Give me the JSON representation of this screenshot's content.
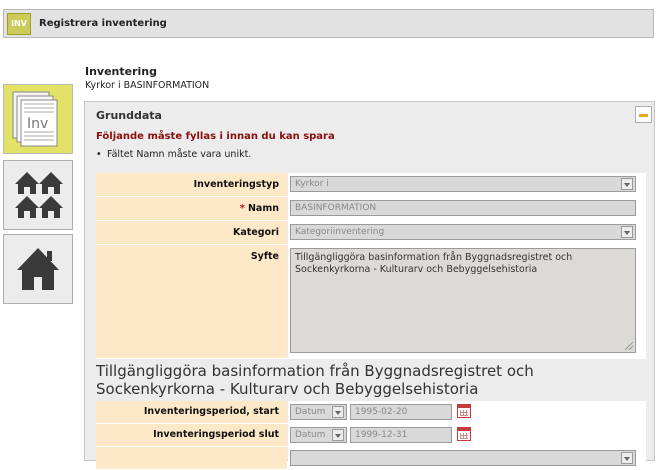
{
  "app": {
    "icon_text": "INV",
    "title": "Registrera inventering"
  },
  "nav": {
    "tiles": [
      {
        "name": "inventering",
        "icon": "document-stack-icon",
        "label": "Inv",
        "active": true
      },
      {
        "name": "groups",
        "icon": "houses-group-icon",
        "active": false
      },
      {
        "name": "building",
        "icon": "house-icon",
        "active": false
      }
    ]
  },
  "header": {
    "title": "Inventering",
    "subtitle": "Kyrkor i BASINFORMATION"
  },
  "panel": {
    "title": "Grunddata",
    "error_title": "Följande måste fyllas i innan du kan spara",
    "errors": [
      "Fältet Namn måste vara unikt."
    ],
    "description": "Tillgängliggöra basinformation från Byggnadsregistret och Sockenkyrkorna - Kulturarv och Bebyggelsehistoria"
  },
  "form": {
    "inventeringstyp": {
      "label": "Inventeringstyp",
      "value": "Kyrkor i"
    },
    "namn": {
      "required_mark": "*",
      "label": "Namn",
      "value": "BASINFORMATION"
    },
    "kategori": {
      "label": "Kategori",
      "value": "Kategoriinventering"
    },
    "syfte": {
      "label": "Syfte",
      "value": "Tillgängliggöra basinformation från Byggnadsregistret och Sockenkyrkorna - Kulturarv och Bebyggelsehistoria"
    },
    "period_start": {
      "label": "Inventeringsperiod, start",
      "datum": "Datum",
      "value": "1995-02-20"
    },
    "period_slut": {
      "label": "Inventeringsperiod slut",
      "datum": "Datum",
      "value": "1999-12-31"
    }
  },
  "colors": {
    "label_bg": "#fde9c8",
    "error_text": "#8b0c0c",
    "active_tile": "#e1e266"
  }
}
